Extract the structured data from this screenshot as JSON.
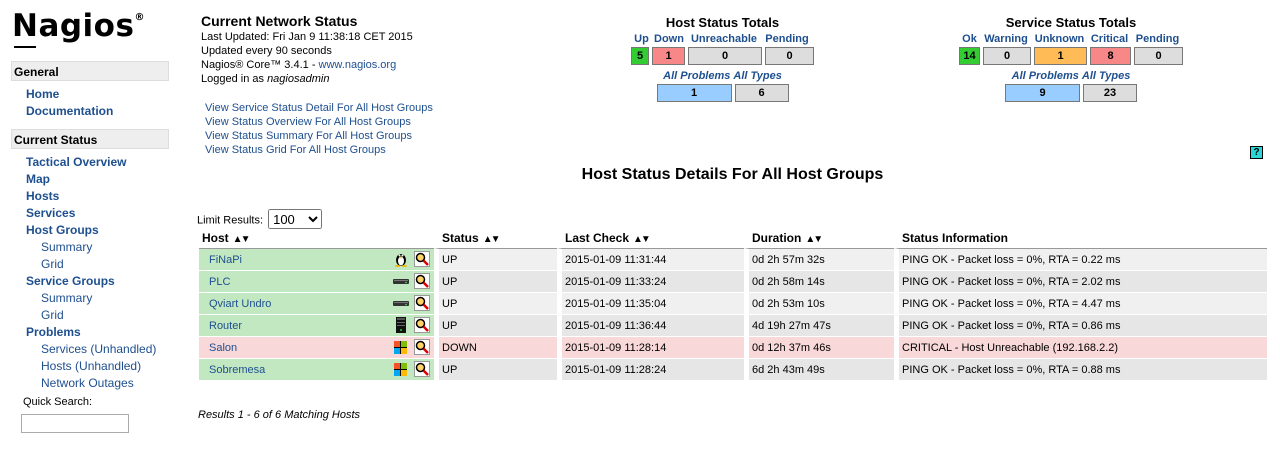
{
  "sidebar": {
    "logo": "Nagios",
    "logo_reg": "®",
    "general_header": "General",
    "home": "Home",
    "documentation": "Documentation",
    "current_status_header": "Current Status",
    "tactical_overview": "Tactical Overview",
    "map": "Map",
    "hosts": "Hosts",
    "services": "Services",
    "host_groups": "Host Groups",
    "hg_summary": "Summary",
    "hg_grid": "Grid",
    "service_groups": "Service Groups",
    "sg_summary": "Summary",
    "sg_grid": "Grid",
    "problems": "Problems",
    "prob_services": "Services",
    "prob_services_unhandled": "Unhandled",
    "prob_hosts": "Hosts",
    "prob_hosts_unhandled": "Unhandled",
    "network_outages": "Network Outages",
    "quick_search_label": "Quick Search:"
  },
  "info": {
    "title": "Current Network Status",
    "last_updated": "Last Updated: Fri Jan 9 11:38:18 CET 2015",
    "update_interval": "Updated every 90 seconds",
    "version_prefix": "Nagios® Core™ 3.4.1 - ",
    "version_link": "www.nagios.org",
    "logged_prefix": "Logged in as ",
    "logged_user": "nagiosadmin"
  },
  "views": [
    "View Service Status Detail For All Host Groups",
    "View Status Overview For All Host Groups",
    "View Status Summary For All Host Groups",
    "View Status Grid For All Host Groups"
  ],
  "host_totals": {
    "title": "Host Status Totals",
    "labels": [
      "Up",
      "Down",
      "Unreachable",
      "Pending"
    ],
    "values": [
      "5",
      "1",
      "0",
      "0"
    ],
    "colors": [
      "#33cc33",
      "#f88888",
      "#dddddd",
      "#dddddd"
    ],
    "all_problems_label": "All Problems",
    "all_types_label": "All Types",
    "all_problems": "1",
    "all_types": "6"
  },
  "service_totals": {
    "title": "Service Status Totals",
    "labels": [
      "Ok",
      "Warning",
      "Unknown",
      "Critical",
      "Pending"
    ],
    "values": [
      "14",
      "0",
      "1",
      "8",
      "0"
    ],
    "colors": [
      "#33cc33",
      "#dddddd",
      "#ffbb55",
      "#f88888",
      "#dddddd"
    ],
    "all_problems_label": "All Problems",
    "all_types_label": "All Types",
    "all_problems": "9",
    "all_types": "23"
  },
  "help_label": "?",
  "page_title": "Host Status Details For All Host Groups",
  "limit": {
    "label": "Limit Results:",
    "selected": "100"
  },
  "table": {
    "headers": [
      "Host",
      "Status",
      "Last Check",
      "Duration",
      "Status Information"
    ],
    "rows": [
      {
        "host": "FiNaPi",
        "os": "linux",
        "status": "UP",
        "last_check": "2015-01-09 11:31:44",
        "duration": "0d 2h 57m 32s",
        "info": "PING OK - Packet loss = 0%, RTA = 0.22 ms"
      },
      {
        "host": "PLC",
        "os": "device",
        "status": "UP",
        "last_check": "2015-01-09 11:33:24",
        "duration": "0d 2h 58m 14s",
        "info": "PING OK - Packet loss = 0%, RTA = 2.02 ms"
      },
      {
        "host": "Qviart Undro",
        "os": "device",
        "status": "UP",
        "last_check": "2015-01-09 11:35:04",
        "duration": "0d 2h 53m 10s",
        "info": "PING OK - Packet loss = 0%, RTA = 4.47 ms"
      },
      {
        "host": "Router",
        "os": "router",
        "status": "UP",
        "last_check": "2015-01-09 11:36:44",
        "duration": "4d 19h 27m 47s",
        "info": "PING OK - Packet loss = 0%, RTA = 0.86 ms"
      },
      {
        "host": "Salon",
        "os": "windows",
        "status": "DOWN",
        "last_check": "2015-01-09 11:28:14",
        "duration": "0d 12h 37m 46s",
        "info": "CRITICAL - Host Unreachable (192.168.2.2)"
      },
      {
        "host": "Sobremesa",
        "os": "windows",
        "status": "UP",
        "last_check": "2015-01-09 11:28:24",
        "duration": "6d 2h 43m 49s",
        "info": "PING OK - Packet loss = 0%, RTA = 0.88 ms"
      }
    ]
  },
  "results": "Results 1 - 6 of 6 Matching Hosts"
}
